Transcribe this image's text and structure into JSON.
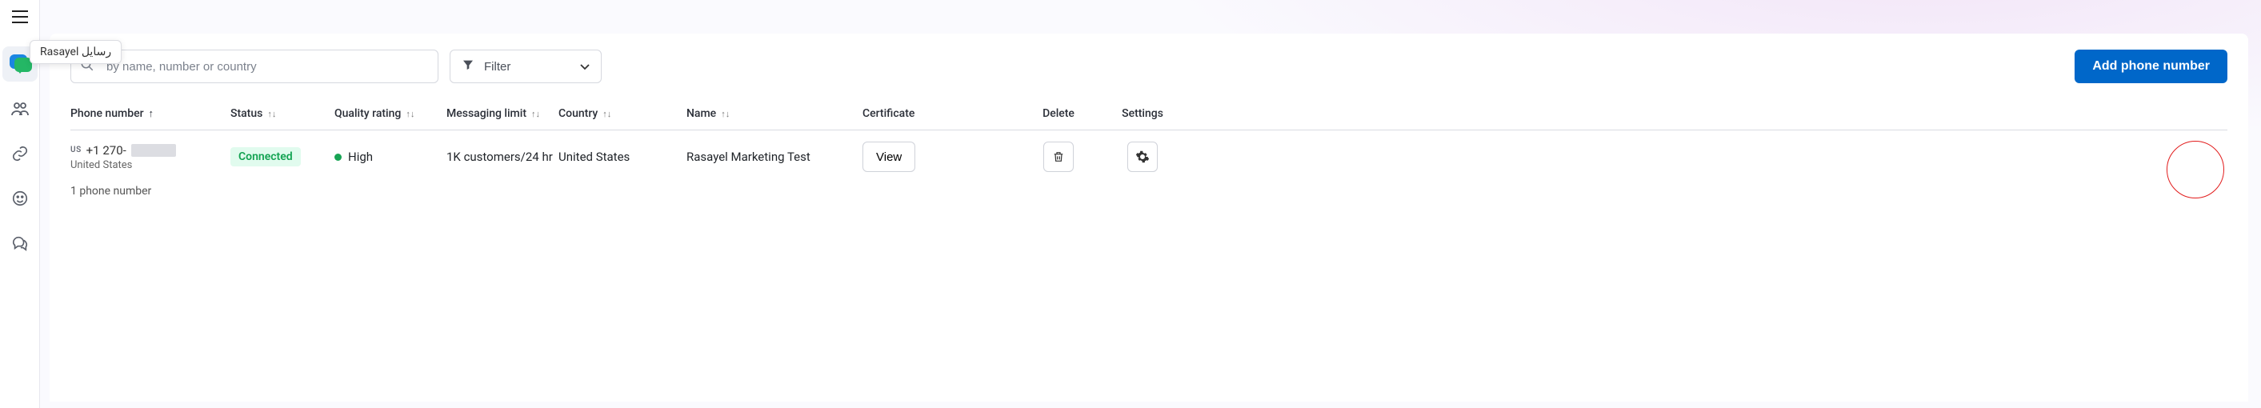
{
  "tooltip": {
    "text": "Rasayel رسايل"
  },
  "search": {
    "placeholder": "by name, number or country"
  },
  "filter": {
    "label": "Filter"
  },
  "add_button": {
    "label": "Add phone number"
  },
  "columns": {
    "phone": "Phone number",
    "status": "Status",
    "quality": "Quality rating",
    "limit": "Messaging limit",
    "country": "Country",
    "name": "Name",
    "certificate": "Certificate",
    "delete": "Delete",
    "settings": "Settings"
  },
  "row": {
    "cc": "US",
    "prefix": "+1 270-",
    "country_sub": "United States",
    "status": "Connected",
    "quality": "High",
    "limit": "1K customers/24 hr",
    "country": "United States",
    "name": "Rasayel Marketing Test",
    "view": "View"
  },
  "footer": {
    "count": "1 phone number"
  }
}
